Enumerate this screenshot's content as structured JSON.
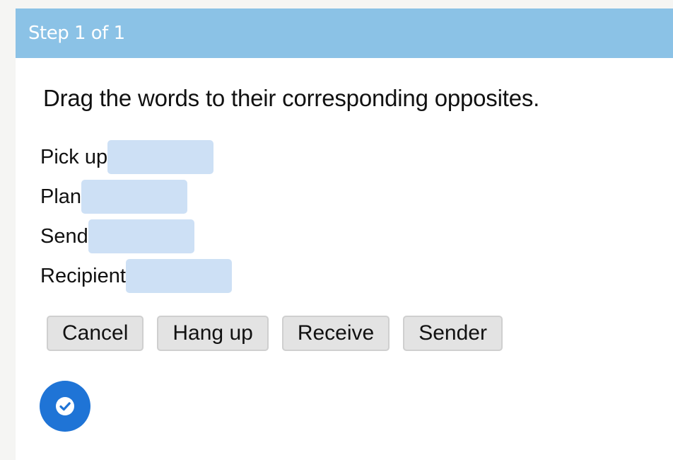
{
  "header": {
    "step_label": "Step 1 of 1"
  },
  "activity": {
    "instruction": "Drag the words to their corresponding opposites.",
    "targets": [
      {
        "label": "Pick up"
      },
      {
        "label": "Plan"
      },
      {
        "label": "Send"
      },
      {
        "label": "Recipient"
      }
    ],
    "choices": [
      "Cancel",
      "Hang up",
      "Receive",
      "Sender"
    ]
  },
  "controls": {
    "submit_icon": "check-circle-icon"
  },
  "colors": {
    "header_bg": "#8bc2e6",
    "drop_zone_bg": "#cde0f5",
    "choice_bg": "#e3e3e3",
    "submit_bg": "#1f74d6"
  }
}
